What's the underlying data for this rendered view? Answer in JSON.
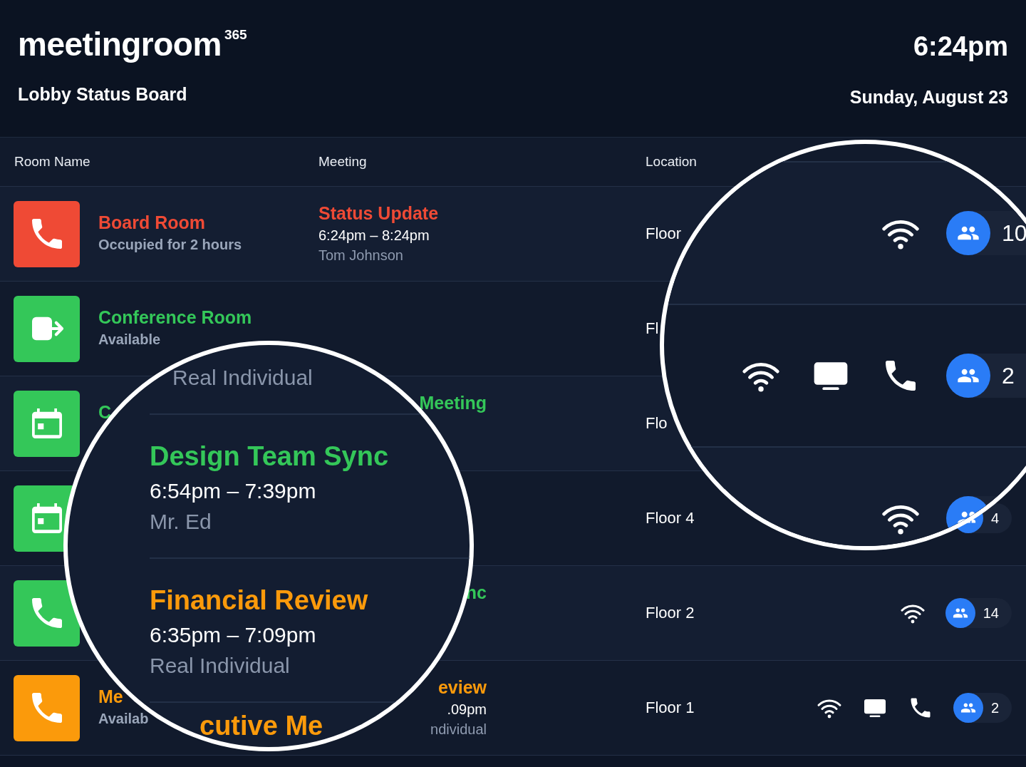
{
  "header": {
    "logo": "meetingroom",
    "logo_superscript": "365",
    "subtitle": "Lobby Status Board",
    "time": "6:24pm",
    "date": "Sunday, August 23"
  },
  "table": {
    "columns": [
      "Room Name",
      "Meeting",
      "Location"
    ],
    "rows": [
      {
        "kind": "phone",
        "color": "#ef4a35",
        "room_name": "Board Room",
        "room_status": "Occupied for 2 hours",
        "meeting": {
          "title": "Status Update",
          "time": "6:24pm – 8:24pm",
          "organizer": "Tom Johnson",
          "cut": false
        },
        "location": "Floor"
      },
      {
        "kind": "exit",
        "color": "#34c759",
        "room_name": "Conference Room",
        "room_status": "Available",
        "location": "Fl"
      },
      {
        "kind": "calendar",
        "color": "#34c759",
        "room_name": "C",
        "meeting": {
          "title": "Meeting",
          "cut": true
        },
        "location": "Flo"
      },
      {
        "kind": "calendar",
        "color": "#34c759",
        "location": "Floor 4",
        "capacity": "4"
      },
      {
        "kind": "phone",
        "color": "#34c759",
        "meeting": {
          "title": "nc",
          "cut": true
        },
        "location": "Floor 2",
        "amenities": [
          {
            "kind": "wifi"
          }
        ],
        "capacity": "14"
      },
      {
        "kind": "phone",
        "color": "#fb9a0b",
        "room_name": "Me",
        "room_status": "Availab",
        "meeting": {
          "title": "eview",
          "time": ".09pm",
          "organizer": "ndividual",
          "cut": true
        },
        "location": "Floor 1",
        "amenities": [
          {
            "kind": "wifi"
          },
          {
            "kind": "display"
          },
          {
            "kind": "phone"
          }
        ],
        "capacity": "2"
      }
    ]
  },
  "meeting_lens": {
    "meetings": [
      {
        "organizer": "Real Individual"
      },
      {
        "title": "Design Team Sync",
        "color": "#34c759",
        "time": "6:54pm – 7:39pm",
        "organizer": "Mr. Ed"
      },
      {
        "title": "Financial Review",
        "color": "#fb9a0b",
        "time": "6:35pm – 7:09pm",
        "organizer": "Real Individual"
      },
      {
        "title": "cutive Me",
        "color": "#fb9a0b",
        "cut": true
      }
    ]
  },
  "amenity_lens": {
    "rows": [
      {
        "amenities": [
          {
            "kind": "wifi"
          }
        ],
        "capacity": "10"
      },
      {
        "amenities": [
          {
            "kind": "wifi"
          },
          {
            "kind": "display"
          },
          {
            "kind": "phone"
          }
        ],
        "capacity": "2"
      },
      {
        "amenities": [
          {
            "kind": "wifi"
          }
        ]
      }
    ]
  }
}
